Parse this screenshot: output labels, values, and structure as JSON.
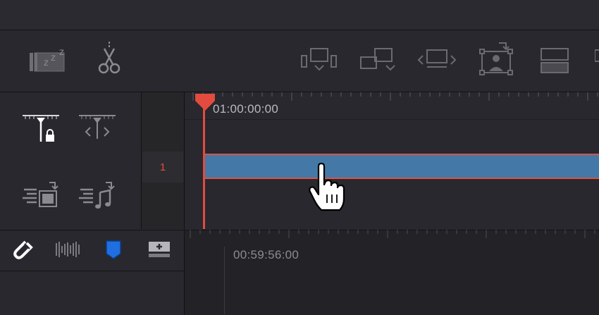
{
  "timeline": {
    "track_number": "1",
    "timecode_main": "01:00:00:00",
    "timecode_overview": "00:59:56:00"
  },
  "icons": {
    "toolbar": [
      "snooze-icon",
      "scissors-icon",
      "smart-insert-icon",
      "append-icon",
      "ripple-overwrite-icon",
      "close-up-icon",
      "place-on-top-icon",
      "source-overwrite-icon"
    ],
    "left_panel": [
      "trim-lock-icon",
      "dynamic-trim-icon",
      "audio-video-icon",
      "audio-only-icon"
    ],
    "bottom": [
      "snapping-magnet-icon",
      "audio-waveform-icon",
      "flag-icon",
      "add-track-icon"
    ],
    "cursor": "hand-pointer-icon"
  },
  "colors": {
    "accent_red": "#e34b3f",
    "clip_blue": "#4478a6",
    "flag_blue": "#1f6fe0",
    "background": "#28282e"
  }
}
